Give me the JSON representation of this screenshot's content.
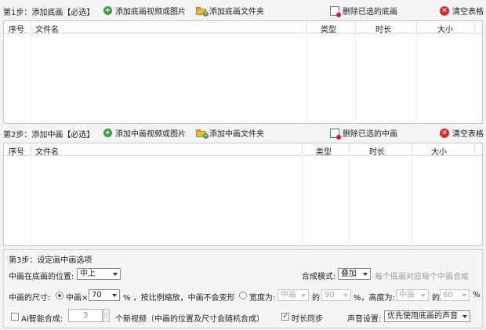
{
  "step1": {
    "title": "第1步：添加底画【必选】",
    "add_media": "添加底画视频或图片",
    "add_folder": "添加底画文件夹",
    "delete_selected": "删除已选的底画",
    "clear_table": "清空表格",
    "columns": [
      "序号",
      "文件名",
      "类型",
      "时长",
      "大小"
    ]
  },
  "step2": {
    "title": "第2步：添加中画【必选】",
    "add_media": "添加中画视频或图片",
    "add_folder": "添加中画文件夹",
    "delete_selected": "删除已选的中画",
    "clear_table": "清空表格",
    "columns": [
      "序号",
      "文件名",
      "类型",
      "时长",
      "大小"
    ]
  },
  "step3": {
    "title": "第3步：设定画中画选项",
    "position_label": "中画在底画的位置:",
    "position_value": "中上",
    "mode_label": "合成模式:",
    "mode_value": "叠加",
    "mode_hint": "每个底画对应每个中画合成",
    "size_label": "中画的尺寸:",
    "radio_scale_label": "中画×",
    "scale_value": "70",
    "scale_suffix": "% ，按比例缩放，中画不会变形",
    "radio_width_label": "宽度为:",
    "width_ref": "中画",
    "of1": "的",
    "width_value": "90",
    "height_label": "%，高度为:",
    "height_ref": "中画",
    "of2": "的",
    "height_value": "60",
    "percent": "%",
    "ai_label": "AI智能合成:",
    "ai_count": "3",
    "ai_hint": "个新视频（中画的位置及尺寸会随机合成）",
    "sync_label": "时长同步",
    "sync_checked": true,
    "audio_label": "声音设置:",
    "audio_value": "优先使用底画的声音"
  },
  "icons": {
    "add_media": "add-icon",
    "add_folder": "folder-add-icon",
    "delete": "delete-icon",
    "clear": "clear-icon"
  }
}
